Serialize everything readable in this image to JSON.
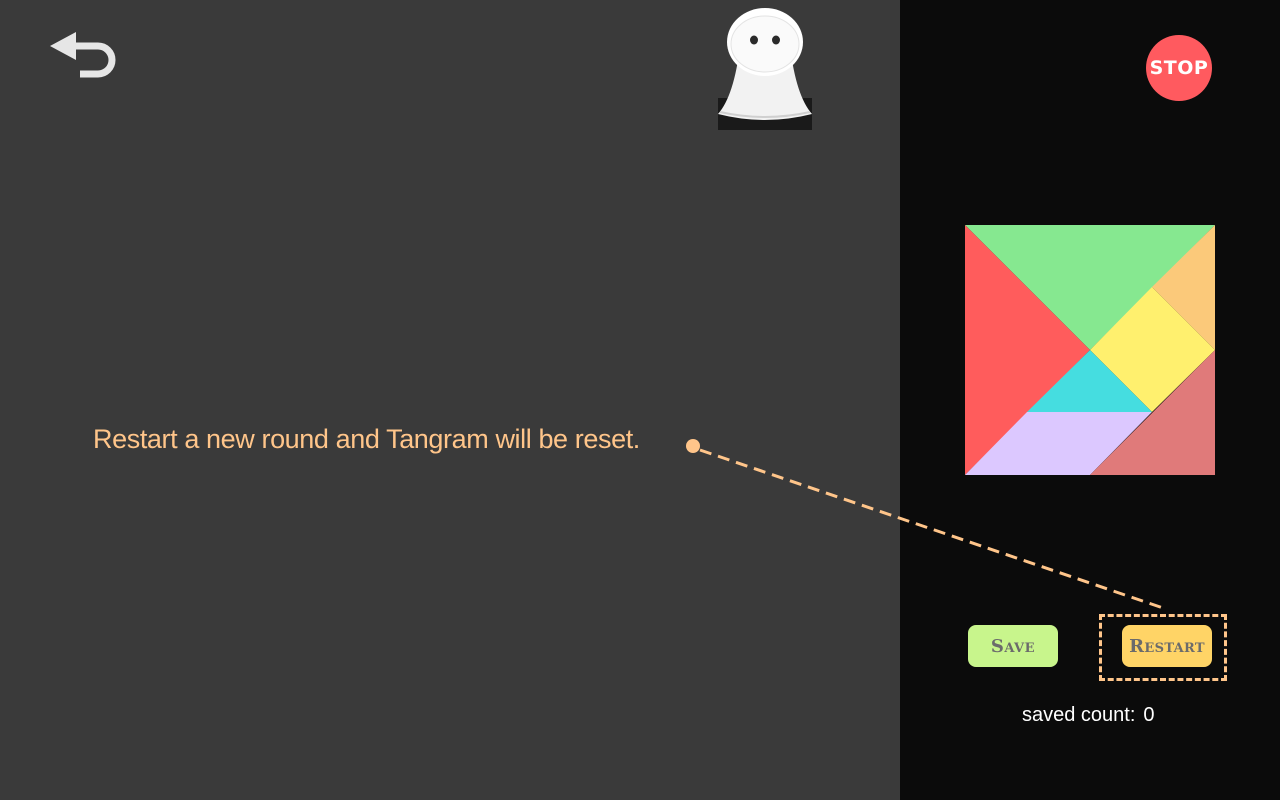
{
  "tutorial": {
    "callout": "Restart a new round and Tangram will be reset."
  },
  "toolbar": {
    "stop_label": "STOP",
    "back_icon": "back-arrow-icon"
  },
  "actions": {
    "save_label": "Save",
    "restart_label": "Restart"
  },
  "stats": {
    "saved_count_label": "saved count:",
    "saved_count_value": "0"
  },
  "colors": {
    "left_background": "#3a3a3a",
    "right_background": "#0b0b0b",
    "callout": "#ffc58a",
    "stop_button": "#ff5a5f",
    "save_button": "#c8f58c",
    "restart_button": "#ffd466",
    "tangram_green": "#86e890",
    "tangram_red": "#ff5c5c",
    "tangram_orange": "#fbc97a",
    "tangram_yellow": "#fff06e",
    "tangram_cyan": "#45dde0",
    "tangram_lavender": "#dcc8ff",
    "tangram_salmon": "#e07a7a"
  }
}
